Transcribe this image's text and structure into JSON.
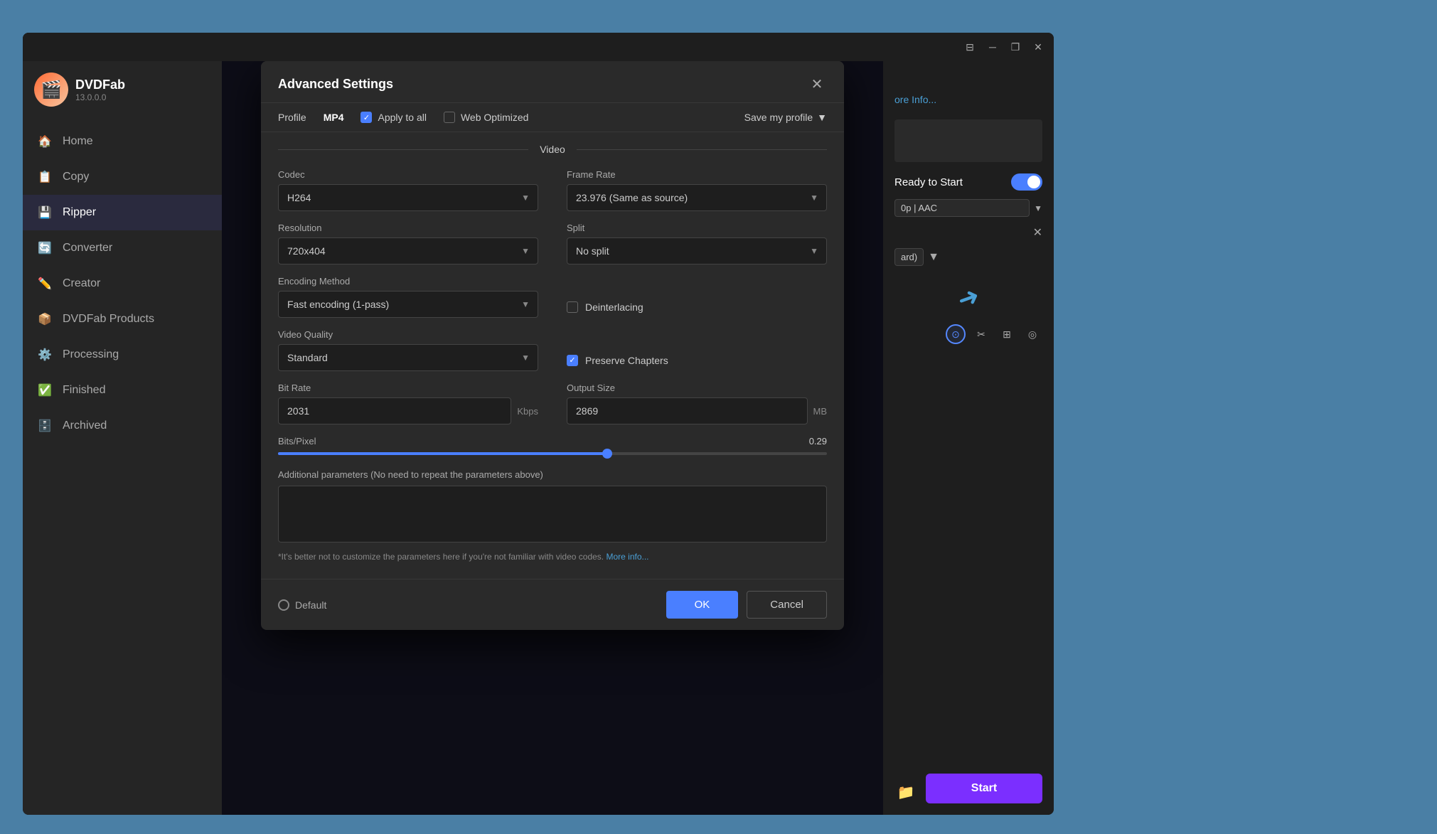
{
  "app": {
    "logo_emoji": "🎬",
    "app_name": "DVDFab",
    "version": "13.0.0.0"
  },
  "sidebar": {
    "items": [
      {
        "id": "home",
        "label": "Home",
        "icon": "🏠",
        "active": false
      },
      {
        "id": "copy",
        "label": "Copy",
        "icon": "📋",
        "active": false
      },
      {
        "id": "ripper",
        "label": "Ripper",
        "icon": "💾",
        "active": true
      },
      {
        "id": "converter",
        "label": "Converter",
        "icon": "🔄",
        "active": false
      },
      {
        "id": "creator",
        "label": "Creator",
        "icon": "✏️",
        "active": false
      },
      {
        "id": "dvdfab_products",
        "label": "DVDFab Products",
        "icon": "📦",
        "active": false
      },
      {
        "id": "processing",
        "label": "Processing",
        "icon": "⚙️",
        "active": false
      },
      {
        "id": "finished",
        "label": "Finished",
        "icon": "✅",
        "active": false
      },
      {
        "id": "archived",
        "label": "Archived",
        "icon": "🗄️",
        "active": false
      }
    ]
  },
  "titlebar": {
    "controls": [
      "⊟",
      "❐",
      "✕"
    ]
  },
  "right_panel": {
    "more_info_label": "ore Info...",
    "ready_to_start_label": "Ready to Start",
    "audio_track": "0p | AAC",
    "quality": "ard)",
    "start_button_label": "Start"
  },
  "dialog": {
    "title": "Advanced Settings",
    "close_icon": "✕",
    "profile_label": "Profile",
    "profile_value": "MP4",
    "apply_to_all_label": "Apply to all",
    "apply_to_all_checked": true,
    "web_optimized_label": "Web Optimized",
    "web_optimized_checked": false,
    "save_profile_label": "Save my profile",
    "video_section_label": "Video",
    "codec_label": "Codec",
    "codec_value": "H264",
    "frame_rate_label": "Frame Rate",
    "frame_rate_value": "23.976 (Same as source)",
    "resolution_label": "Resolution",
    "resolution_value": "720x404",
    "split_label": "Split",
    "split_value": "No split",
    "encoding_method_label": "Encoding Method",
    "encoding_method_value": "Fast encoding (1-pass)",
    "deinterlacing_label": "Deinterlacing",
    "deinterlacing_checked": false,
    "video_quality_label": "Video Quality",
    "video_quality_value": "Standard",
    "preserve_chapters_label": "Preserve Chapters",
    "preserve_chapters_checked": true,
    "bit_rate_label": "Bit Rate",
    "bit_rate_value": "2031",
    "bit_rate_unit": "Kbps",
    "output_size_label": "Output Size",
    "output_size_value": "2869",
    "output_size_unit": "MB",
    "bits_pixel_label": "Bits/Pixel",
    "bits_pixel_value": "0.29",
    "bits_pixel_percent": 60,
    "additional_params_label": "Additional parameters (No need to repeat the parameters above)",
    "additional_params_value": "",
    "warning_text": "*It's better not to customize the parameters here if you're not familiar with video codes.",
    "more_info_link": "More info...",
    "default_label": "Default",
    "ok_label": "OK",
    "cancel_label": "Cancel"
  }
}
